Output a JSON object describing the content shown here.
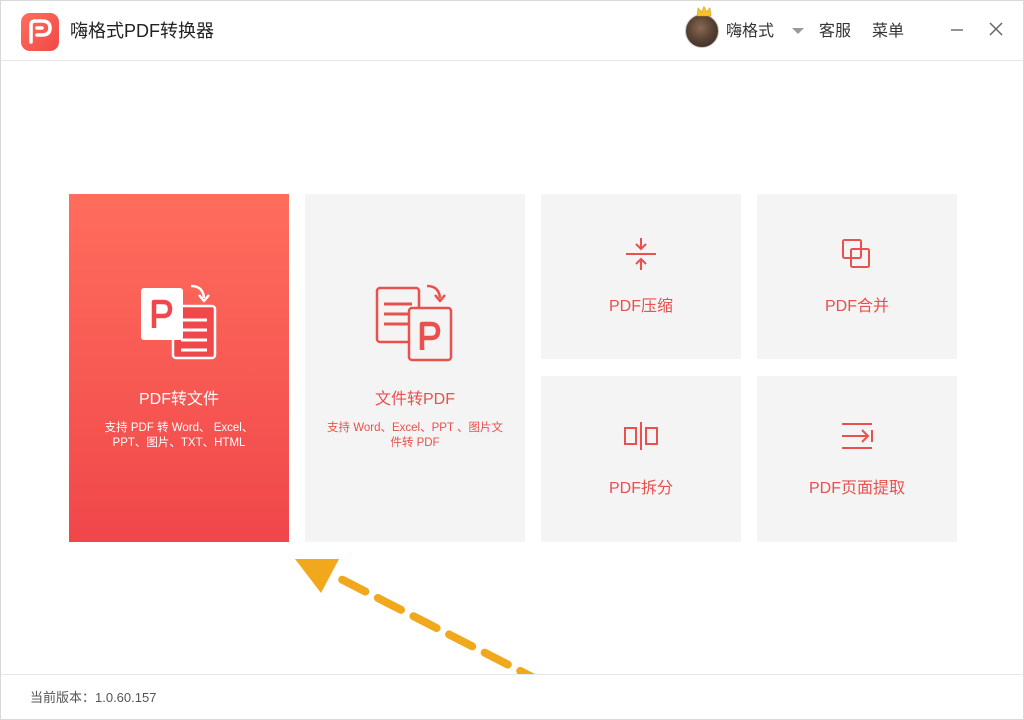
{
  "app": {
    "title": "嗨格式PDF转换器",
    "logo_icon": "pdf-logo-icon",
    "accent_color": "#f0474a"
  },
  "header": {
    "user_name": "嗨格式",
    "service_label": "客服",
    "menu_label": "菜单"
  },
  "tiles": {
    "pdf_to_file": {
      "title": "PDF转文件",
      "desc_line1": "支持 PDF 转 Word、 Excel、",
      "desc_line2": "PPT、图片、TXT、HTML"
    },
    "file_to_pdf": {
      "title": "文件转PDF",
      "desc_line1": "支持 Word、Excel、PPT 、图片文",
      "desc_line2": "件转 PDF"
    },
    "compress": {
      "title": "PDF压缩"
    },
    "merge": {
      "title": "PDF合并"
    },
    "split": {
      "title": "PDF拆分"
    },
    "extract": {
      "title": "PDF页面提取"
    }
  },
  "footer": {
    "version_label": "当前版本：1.0.60.157"
  }
}
